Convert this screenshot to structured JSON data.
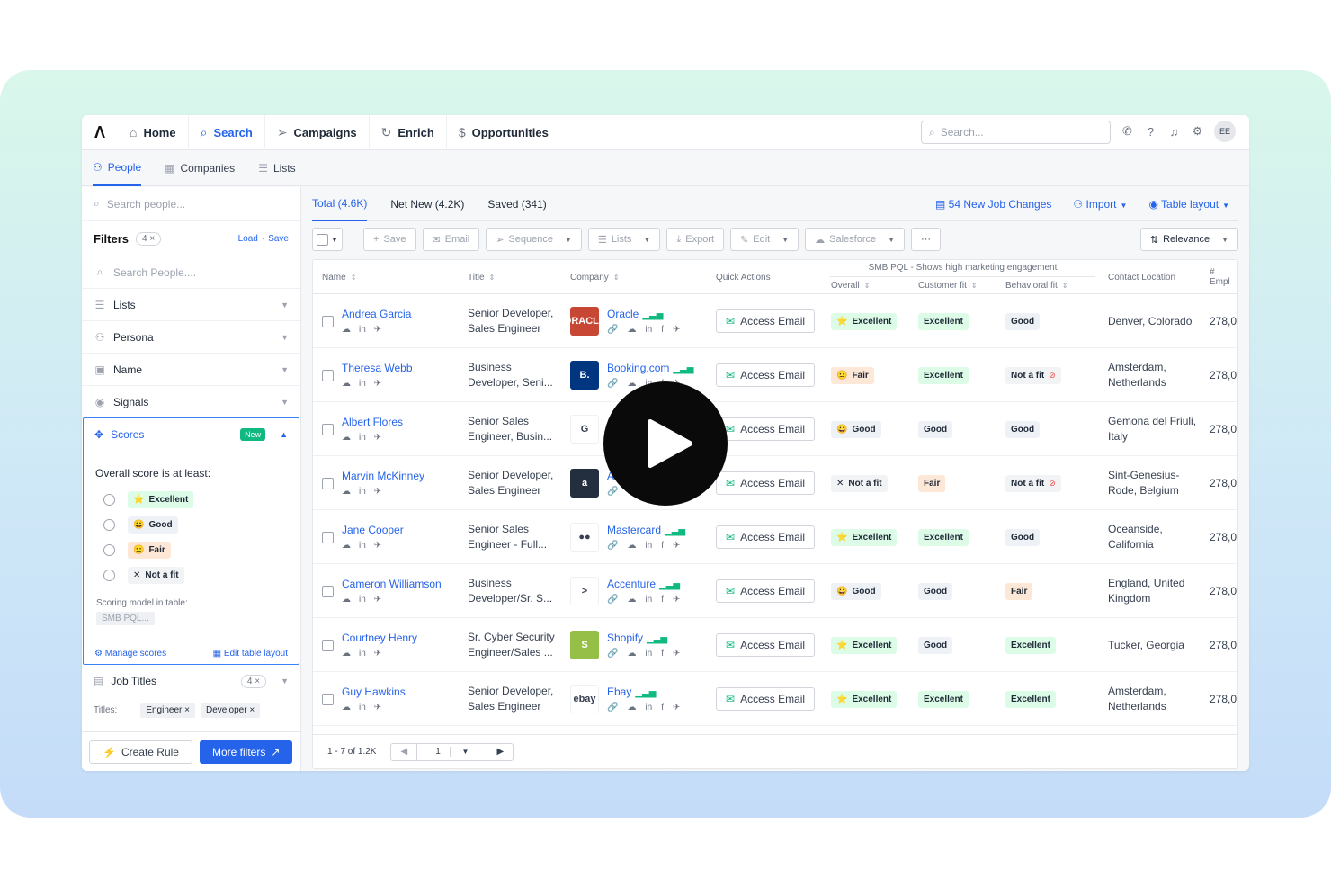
{
  "nav": {
    "logo": "Λ",
    "items": [
      {
        "label": "Home",
        "icon": "⌂",
        "active": false
      },
      {
        "label": "Search",
        "icon": "⌕",
        "active": true
      },
      {
        "label": "Campaigns",
        "icon": "➢",
        "active": false
      },
      {
        "label": "Enrich",
        "icon": "↻",
        "active": false
      },
      {
        "label": "Opportunities",
        "icon": "$",
        "active": false
      }
    ],
    "search_placeholder": "Search...",
    "avatar": "EE"
  },
  "subnav": {
    "items": [
      {
        "label": "People",
        "active": true
      },
      {
        "label": "Companies",
        "active": false
      },
      {
        "label": "Lists",
        "active": false
      }
    ]
  },
  "sidebar": {
    "search_placeholder": "Search people...",
    "filters_title": "Filters",
    "filters_count": "4 ×",
    "load": "Load",
    "save": "Save",
    "search_people_placeholder": "Search People....",
    "rows": [
      "Lists",
      "Persona",
      "Name",
      "Signals"
    ],
    "scores": {
      "title": "Scores",
      "new_badge": "New",
      "prompt": "Overall score is at least:",
      "options": [
        "Excellent",
        "Good",
        "Fair",
        "Not a fit"
      ],
      "scoring_model_label": "Scoring model in table:",
      "scoring_model_value": "SMB PQL...",
      "manage": "Manage scores",
      "edit_layout": "Edit table layout"
    },
    "job_titles": {
      "title": "Job Titles",
      "count": "4 ×",
      "titles_label": "Titles:",
      "chips": [
        "Engineer ×",
        "Developer ×"
      ]
    },
    "create_rule": "Create Rule",
    "more_filters": "More filters"
  },
  "main": {
    "tabs": [
      {
        "label": "Total (4.6K)",
        "active": true
      },
      {
        "label": "Net New (4.2K)",
        "active": false
      },
      {
        "label": "Saved (341)",
        "active": false
      }
    ],
    "job_changes": "54 New Job Changes",
    "import": "Import",
    "table_layout": "Table layout",
    "toolbar": [
      "Save",
      "Email",
      "Sequence",
      "Lists",
      "Export",
      "Edit",
      "Salesforce"
    ],
    "more": "···",
    "relevance": "Relevance",
    "columns": {
      "name": "Name",
      "title": "Title",
      "company": "Company",
      "quick_actions": "Quick Actions",
      "smb": "SMB PQL - Shows high marketing engagement",
      "overall": "Overall",
      "customer_fit": "Customer fit",
      "behavioral_fit": "Behavioral fit",
      "location": "Contact Location",
      "employees": "# Empl"
    },
    "access_email": "Access Email",
    "rows": [
      {
        "name": "Andrea Garcia",
        "title": "Senior Developer, Sales Engineer",
        "company": "Oracle",
        "logo": "ORACLE",
        "logo_bg": "#c74634",
        "overall": "Excellent",
        "customer": "Excellent",
        "behavioral": "Good",
        "location": "Denver, Colorado",
        "employees": "278,0"
      },
      {
        "name": "Theresa Webb",
        "title": "Business Developer, Seni...",
        "company": "Booking.com",
        "logo": "B.",
        "logo_bg": "#003580",
        "overall": "Fair",
        "customer": "Excellent",
        "behavioral": "Not a fit",
        "location": "Amsterdam, Netherlands",
        "employees": "278,0"
      },
      {
        "name": "Albert Flores",
        "title": "Senior Sales Engineer, Busin...",
        "company": "",
        "logo": "G",
        "logo_bg": "#ffffff",
        "overall": "Good",
        "customer": "Good",
        "behavioral": "Good",
        "location": "Gemona del Friuli, Italy",
        "employees": "278,0"
      },
      {
        "name": "Marvin McKinney",
        "title": "Senior Developer, Sales Engineer",
        "company": "A",
        "logo": "a",
        "logo_bg": "#232f3e",
        "overall": "Not a fit",
        "customer": "Fair",
        "behavioral": "Not a fit",
        "location": "Sint-Genesius-Rode, Belgium",
        "employees": "278,0"
      },
      {
        "name": "Jane Cooper",
        "title": "Senior Sales Engineer - Full...",
        "company": "Mastercard",
        "logo": "●●",
        "logo_bg": "#ffffff",
        "overall": "Excellent",
        "customer": "Excellent",
        "behavioral": "Good",
        "location": "Oceanside, California",
        "employees": "278,0"
      },
      {
        "name": "Cameron Williamson",
        "title": "Business Developer/Sr. S...",
        "company": "Accenture",
        "logo": ">",
        "logo_bg": "#ffffff",
        "overall": "Good",
        "customer": "Good",
        "behavioral": "Fair",
        "location": "England, United Kingdom",
        "employees": "278,0"
      },
      {
        "name": "Courtney Henry",
        "title": "Sr. Cyber Security Engineer/Sales ...",
        "company": "Shopify",
        "logo": "S",
        "logo_bg": "#95bf47",
        "overall": "Excellent",
        "customer": "Good",
        "behavioral": "Excellent",
        "location": "Tucker, Georgia",
        "employees": "278,0"
      },
      {
        "name": "Guy Hawkins",
        "title": "Senior Developer, Sales Engineer",
        "company": "Ebay",
        "logo": "ebay",
        "logo_bg": "#ffffff",
        "overall": "Excellent",
        "customer": "Excellent",
        "behavioral": "Excellent",
        "location": "Amsterdam, Netherlands",
        "employees": "278,0"
      }
    ],
    "pager_text": "1 - 7 of 1.2K",
    "pager_page": "1"
  }
}
